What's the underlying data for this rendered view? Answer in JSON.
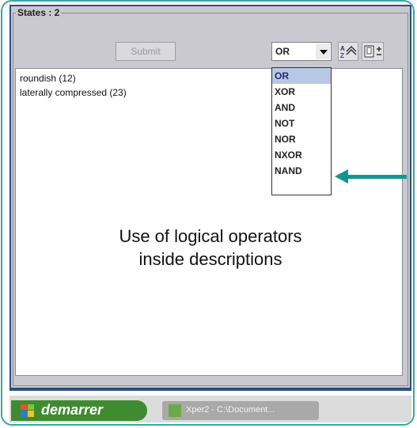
{
  "group": {
    "title": "States : 2"
  },
  "toolbar": {
    "submit_label": "Submit",
    "operator_selected": "OR",
    "sort_icon": "sort-az-icon",
    "expand_icon": "expand-icon"
  },
  "states": [
    {
      "label": "roundish (12)"
    },
    {
      "label": "laterally compressed (23)"
    }
  ],
  "operators": [
    "OR",
    "XOR",
    "AND",
    "NOT",
    "NOR",
    "NXOR",
    "NAND"
  ],
  "annotation": {
    "line1": "Use of logical operators",
    "line2": "inside descriptions"
  },
  "taskbar": {
    "start_label": "demarrer",
    "task_label": "Xper2 - C:\\Document..."
  },
  "colors": {
    "frame": "#38a8a4",
    "arrow": "#14948e",
    "start": "#3e8c2f",
    "selection": "#b8c8e4"
  }
}
